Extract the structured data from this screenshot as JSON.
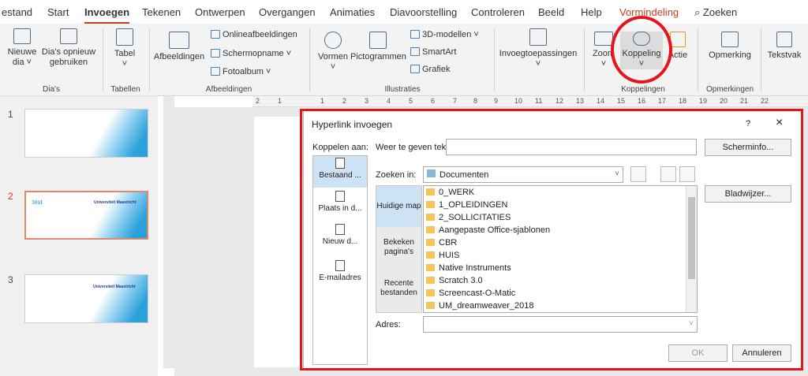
{
  "tabs": [
    "estand",
    "Start",
    "Invoegen",
    "Tekenen",
    "Ontwerpen",
    "Overgangen",
    "Animaties",
    "Diavoorstelling",
    "Controleren",
    "Beeld",
    "Help",
    "Vormindeling"
  ],
  "search_label": "Zoeken",
  "ribbon": {
    "new_slide": "Nieuwe dia",
    "reuse_slides": "Dia's opnieuw gebruiken",
    "table": "Tabel",
    "images": "Afbeeldingen",
    "online_images": "Onlineafbeeldingen",
    "screenshot": "Schermopname",
    "photo_album": "Fotoalbum",
    "shapes": "Vormen",
    "icons": "Pictogrammen",
    "models3d": "3D-modellen",
    "smartart": "SmartArt",
    "chart": "Grafiek",
    "addins": "Invoegtoepassingen",
    "zoom": "Zoom",
    "link": "Koppeling",
    "action": "Actie",
    "comment": "Opmerking",
    "textbox": "Tekstvak",
    "groups": {
      "slides": "Dia's",
      "tables": "Tabellen",
      "images": "Afbeeldingen",
      "illustrations": "Illustraties",
      "links": "Koppelingen",
      "comments": "Opmerkingen"
    }
  },
  "ruler_numbers": [
    "2",
    "1",
    "1",
    "2",
    "3",
    "4",
    "5",
    "6",
    "7",
    "8",
    "9",
    "10",
    "11",
    "12",
    "13",
    "14",
    "15",
    "16",
    "17",
    "18",
    "19",
    "20",
    "21",
    "22"
  ],
  "slides": [
    {
      "num": "1",
      "title": ""
    },
    {
      "num": "2",
      "title": "test",
      "brand": "Universiteit Maastricht"
    },
    {
      "num": "3",
      "title": "",
      "brand": "Universiteit Maastricht"
    }
  ],
  "dialog": {
    "title": "Hyperlink invoegen",
    "help": "?",
    "close": "×",
    "link_to_label": "Koppelen aan:",
    "text_to_display_label": "Weer te geven tekst:",
    "screen_tip": "Scherminfo...",
    "look_in_label": "Zoeken in:",
    "look_in_value": "Documenten",
    "bookmark": "Bladwijzer...",
    "address_label": "Adres:",
    "ok": "OK",
    "cancel": "Annuleren",
    "link_options": [
      "Bestaand ...",
      "Plaats in d...",
      "Nieuw d...",
      "E-mailadres"
    ],
    "nav_options": [
      "Huidige map",
      "Bekeken pagina's",
      "Recente bestanden"
    ],
    "files": [
      "0_WERK",
      "1_OPLEIDINGEN",
      "2_SOLLICITATIES",
      "Aangepaste Office-sjablonen",
      "CBR",
      "HUIS",
      "Native Instruments",
      "Scratch 3.0",
      "Screencast-O-Matic",
      "UM_dreamweaver_2018"
    ]
  },
  "colors": {
    "accent": "#c43e1c",
    "highlight": "#e8141b",
    "selection": "#cde3f5"
  }
}
